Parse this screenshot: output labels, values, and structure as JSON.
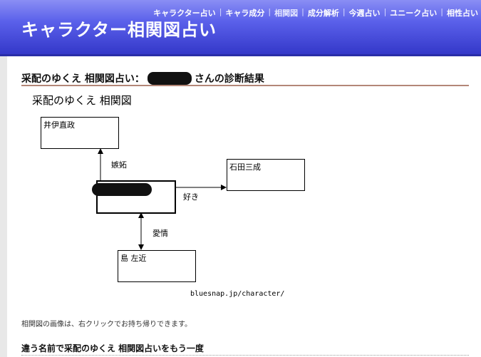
{
  "site": {
    "title": "キャラクター相関図占い"
  },
  "nav": [
    {
      "label": "キャラクター占い"
    },
    {
      "label": "キャラ成分"
    },
    {
      "label": "相関図"
    },
    {
      "label": "成分解析"
    },
    {
      "label": "今週占い"
    },
    {
      "label": "ユニーク占い"
    },
    {
      "label": "相性占い"
    }
  ],
  "result": {
    "heading_prefix": "采配のゆくえ 相関図占い：",
    "heading_suffix": "さんの診断結果"
  },
  "diagram": {
    "title": "采配のゆくえ 相関図",
    "nodes": {
      "top": "井伊直政",
      "right": "石田三成",
      "bottom": "島 左近"
    },
    "relations": {
      "top": "嫉妬",
      "right": "好き",
      "bottom": "愛情"
    },
    "url": "bluesnap.jp/character/"
  },
  "note": "相関図の画像は、右クリックでお持ち帰りできます。",
  "again": "違う名前で采配のゆくえ 相関図占いをもう一度"
}
